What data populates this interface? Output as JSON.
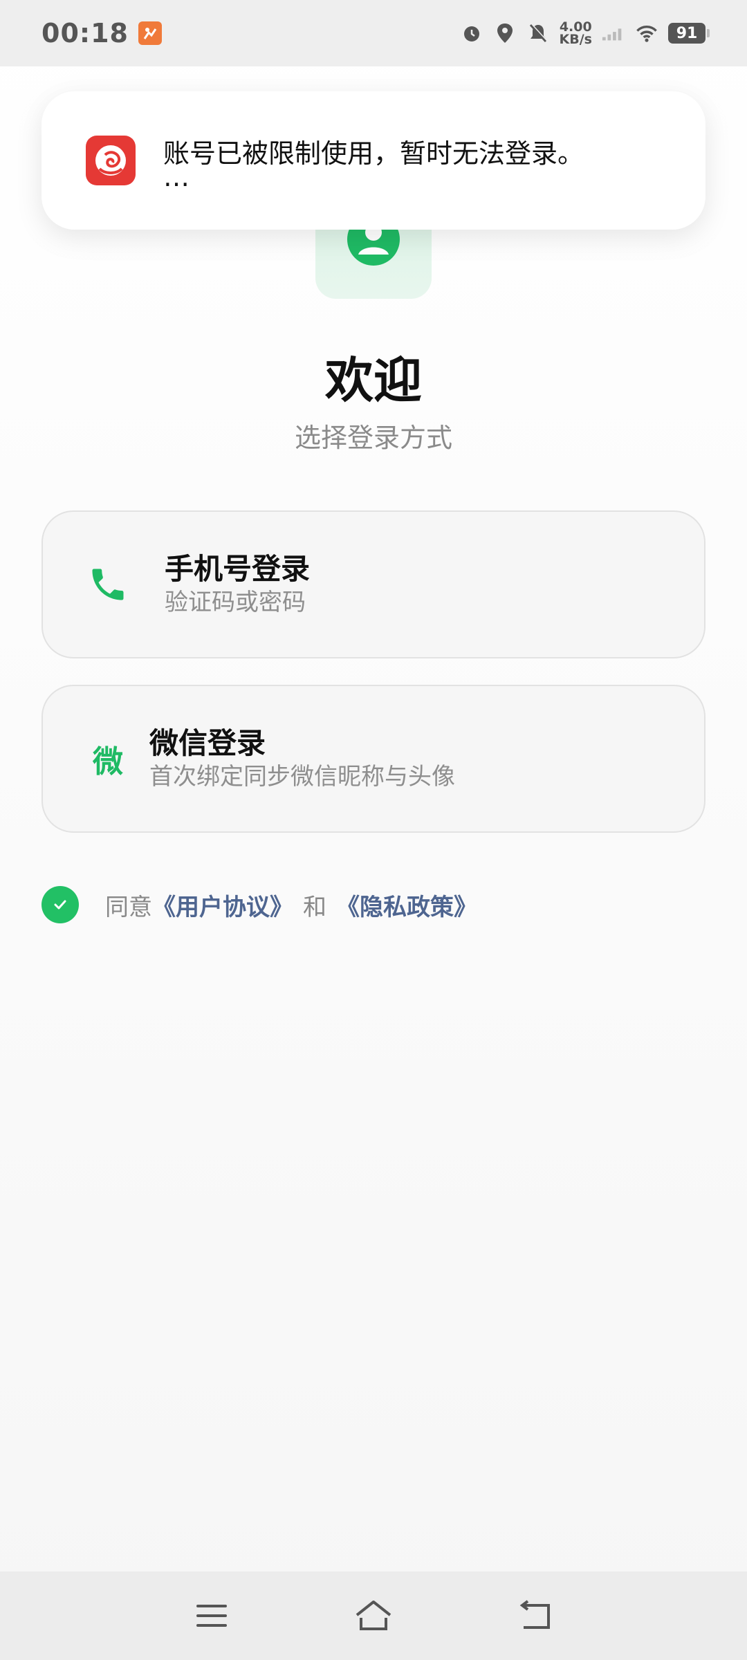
{
  "status_bar": {
    "time": "00:18",
    "net_speed_value": "4.00",
    "net_speed_unit": "KB/s",
    "battery": "91",
    "icons": [
      "alarm-icon",
      "location-icon",
      "mute-icon",
      "signal-icon",
      "wifi-icon",
      "battery-icon"
    ]
  },
  "notification": {
    "title": "账号已被限制使用，暂时无法登录。",
    "more": "…",
    "app_icon": "app-logo-icon",
    "app_color": "#e53935"
  },
  "welcome": {
    "title": "欢迎",
    "subtitle": "选择登录方式"
  },
  "login_options": {
    "phone": {
      "title": "手机号登录",
      "desc": "验证码或密码",
      "icon": "phone-icon"
    },
    "wechat": {
      "title": "微信登录",
      "desc": "首次绑定同步微信昵称与头像",
      "icon_glyph": "微"
    }
  },
  "agreement": {
    "prefix": "同意",
    "user_agreement": "《用户协议》",
    "and": "和",
    "privacy_policy": "《隐私政策》",
    "checked": true
  },
  "nav_bar": {
    "buttons": [
      "menu-icon",
      "home-icon",
      "back-icon"
    ]
  },
  "colors": {
    "accent_green": "#1fba64",
    "link_blue": "#4e6590"
  }
}
